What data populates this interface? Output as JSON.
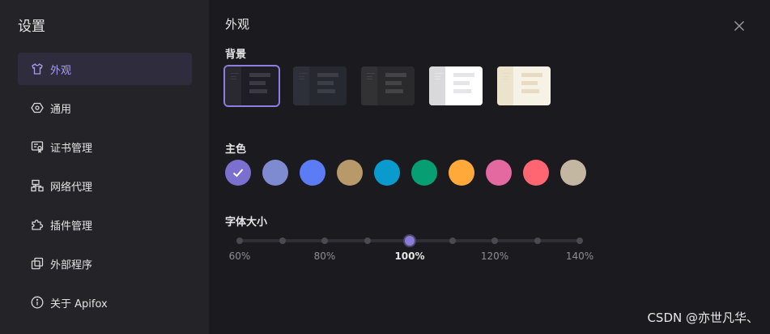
{
  "sidebar": {
    "title": "设置",
    "items": [
      {
        "label": "外观",
        "icon": "shirt-icon",
        "active": true
      },
      {
        "label": "通用",
        "icon": "hexagon-icon",
        "active": false
      },
      {
        "label": "证书管理",
        "icon": "certificate-icon",
        "active": false
      },
      {
        "label": "网络代理",
        "icon": "network-icon",
        "active": false
      },
      {
        "label": "插件管理",
        "icon": "puzzle-icon",
        "active": false
      },
      {
        "label": "外部程序",
        "icon": "windows-icon",
        "active": false
      },
      {
        "label": "关于 Apifox",
        "icon": "info-icon",
        "active": false
      }
    ]
  },
  "main": {
    "title": "外观",
    "close_icon": "close-icon",
    "background": {
      "label": "背景",
      "selected_index": 0,
      "themes": [
        {
          "name": "dark-purple",
          "bg": "#1f1e26",
          "strip": "#2a2932",
          "line": "#3b3a44"
        },
        {
          "name": "dark-slate",
          "bg": "#262930",
          "strip": "#2d3038",
          "line": "#3b3e47"
        },
        {
          "name": "dark-gray",
          "bg": "#2a2a2c",
          "strip": "#323234",
          "line": "#444446"
        },
        {
          "name": "light",
          "bg": "#ffffff",
          "strip": "#d9d9dc",
          "line": "#e6e6e8"
        },
        {
          "name": "cream",
          "bg": "#f7f2e6",
          "strip": "#ebe3cc",
          "line": "#e7dcc2"
        }
      ]
    },
    "primary_color": {
      "label": "主色",
      "selected_index": 0,
      "colors": [
        "#7b6fcf",
        "#7f8bd1",
        "#5b7cf5",
        "#b89a6a",
        "#0a9bce",
        "#079e73",
        "#ffa93a",
        "#e469a1",
        "#ff6672",
        "#c4b7a2"
      ]
    },
    "font_size": {
      "label": "字体大小",
      "value_percent": 100,
      "steps": 9,
      "active_step": 4,
      "labels": [
        "60%",
        "80%",
        "100%",
        "120%",
        "140%"
      ]
    }
  },
  "watermark": "CSDN @亦世凡华、"
}
